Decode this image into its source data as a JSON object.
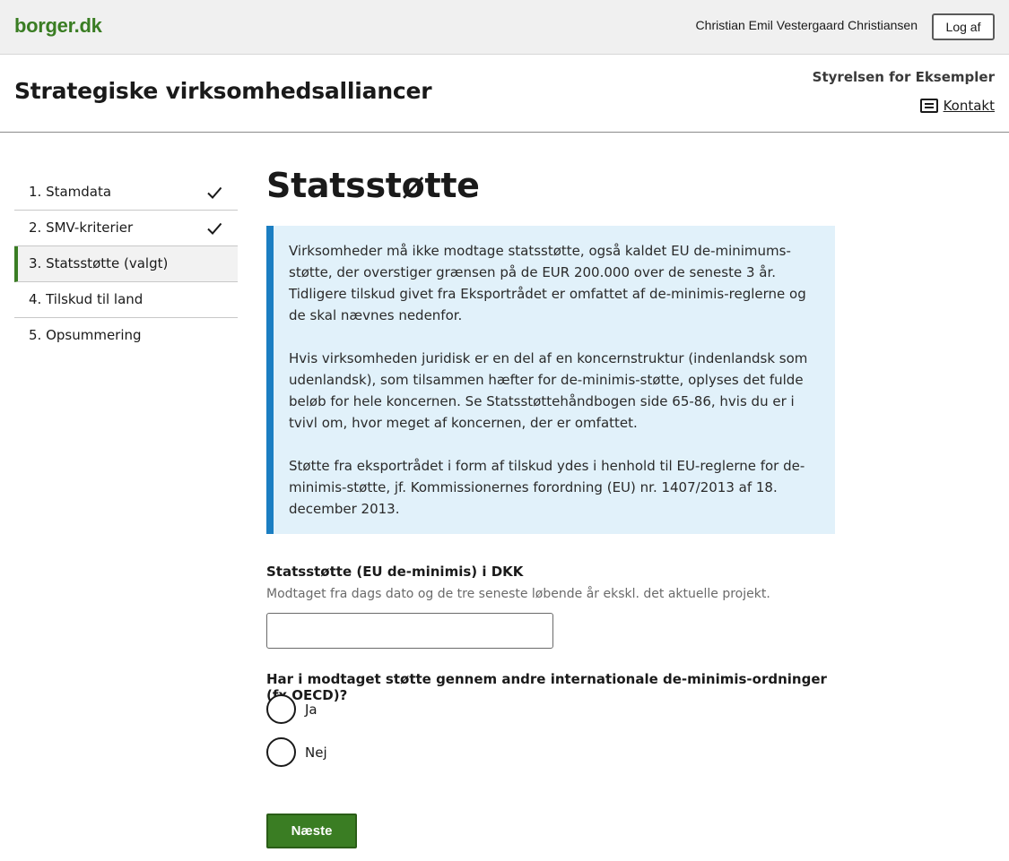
{
  "topbar": {
    "logo": "borger.dk",
    "user_name": "Christian Emil Vestergaard Christiansen",
    "logout_label": "Log af"
  },
  "header": {
    "title": "Strategiske virksomhedsalliancer",
    "authority": "Styrelsen for Eksempler",
    "contact_label": "Kontakt"
  },
  "steps": [
    {
      "label": "1. Stamdata",
      "completed": true
    },
    {
      "label": "2. SMV-kriterier",
      "completed": true
    },
    {
      "label": "3. Statsstøtte (valgt)",
      "active": true
    },
    {
      "label": "4. Tilskud til land"
    },
    {
      "label": "5. Opsummering"
    }
  ],
  "main": {
    "title": "Statsstøtte",
    "info": [
      "Virksomheder må ikke modtage statsstøtte, også kaldet EU de-minimums-støtte, der overstiger grænsen på de EUR 200.000 over de seneste 3 år. Tidligere tilskud givet fra Eksportrådet er omfattet af de-minimis-reglerne og de skal nævnes nedenfor.",
      "Hvis virksomheden juridisk er en del af en koncernstruktur (indenlandsk som udenlandsk), som tilsammen hæfter for de-minimis-støtte, oplyses det fulde beløb for hele koncernen. Se Statsstøttehåndbogen side 65-86, hvis du er i tvivl om, hvor meget af koncernen, der er omfattet.",
      "Støtte fra eksportrådet i form af tilskud ydes i henhold til EU-reglerne for de-minimis-støtte, jf. Kommissionernes forordning (EU) nr. 1407/2013 af 18. december 2013."
    ],
    "field_amount": {
      "label": "Statsstøtte (EU de-minimis) i DKK",
      "hint": "Modtaget fra dags dato og de tre seneste løbende år ekskl. det aktuelle projekt.",
      "value": ""
    },
    "field_international": {
      "label": "Har i modtaget støtte gennem andre internationale de-minimis-ordninger (fx OECD)?",
      "options": [
        "Ja",
        "Nej"
      ]
    },
    "next_label": "Næste"
  }
}
